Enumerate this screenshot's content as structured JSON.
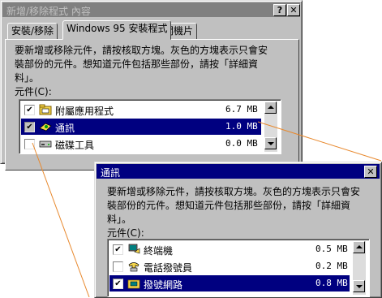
{
  "main": {
    "title": "新增/移除程式 內容",
    "help_btn": "?",
    "close_btn": "✕",
    "tabs": [
      {
        "label": "安裝/移除"
      },
      {
        "label": "Windows 95 安裝程式"
      },
      {
        "label": "開機片"
      }
    ],
    "description": "要新增或移除元件，請按核取方塊。灰色的方塊表示只會安\n裝部份的元件。想知道元件包括那些部份，請按「詳細資\n料」。",
    "list_label": "元件(C):",
    "components": [
      {
        "checked": "✔",
        "name": "附屬應用程式",
        "size": "6.7 MB",
        "icon": "accessories-icon"
      },
      {
        "checked": "✔",
        "name": "通訊",
        "size": "1.0 MB",
        "icon": "communications-icon",
        "selected": true
      },
      {
        "checked": "",
        "name": "磁碟工具",
        "size": "0.0 MB",
        "icon": "disk-tools-icon"
      }
    ]
  },
  "sub": {
    "title": "通訊",
    "close_btn": "✕",
    "description": "要新增或移除元件，請按核取方塊。灰色的方塊表示只會安\n裝部份的元件。想知道元件包括那些部份，請按「詳細資\n料」。",
    "list_label": "元件(C):",
    "components": [
      {
        "checked": "✔",
        "name": "終端機",
        "size": "0.5 MB",
        "icon": "terminal-icon"
      },
      {
        "checked": "",
        "name": "電話撥號員",
        "size": "0.2 MB",
        "icon": "phone-dialer-icon"
      },
      {
        "checked": "✔",
        "name": "撥號網路",
        "size": "0.8 MB",
        "icon": "dial-up-networking-icon",
        "selected": true
      }
    ]
  },
  "colors": {
    "callout_line": "#e8892e",
    "title_active": "#000080",
    "title_inactive": "#808080",
    "face": "#c0c0c0"
  }
}
